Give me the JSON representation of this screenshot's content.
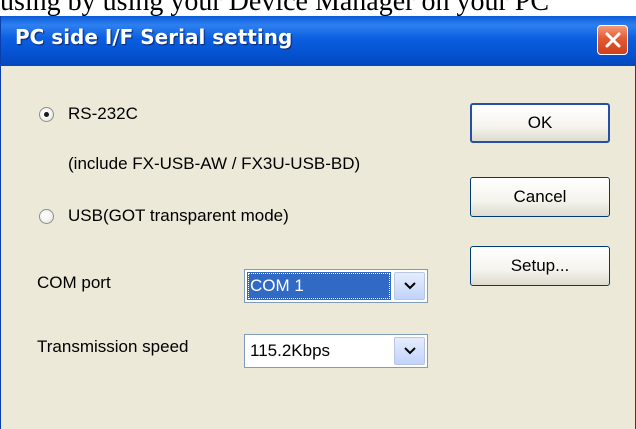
{
  "background_text": "using by using your Device Manager on your PC",
  "window": {
    "title": "PC side I/F  Serial setting"
  },
  "connection": {
    "options": [
      {
        "label": "RS-232C",
        "checked": true
      },
      {
        "label": "USB(GOT transparent mode)",
        "checked": false
      }
    ],
    "rs232_note": "(include FX-USB-AW / FX3U-USB-BD)"
  },
  "com_port": {
    "label": "COM port",
    "value": "COM 1"
  },
  "transmission_speed": {
    "label": "Transmission speed",
    "value": "115.2Kbps"
  },
  "buttons": {
    "ok": "OK",
    "cancel": "Cancel",
    "setup": "Setup..."
  },
  "icons": {
    "close": "close-icon",
    "dropdown": "chevron-down-icon"
  },
  "colors": {
    "titlebar": "#0552d0",
    "close_button": "#e35a32",
    "dialog_face": "#ece9d8",
    "selection": "#316ac5"
  }
}
